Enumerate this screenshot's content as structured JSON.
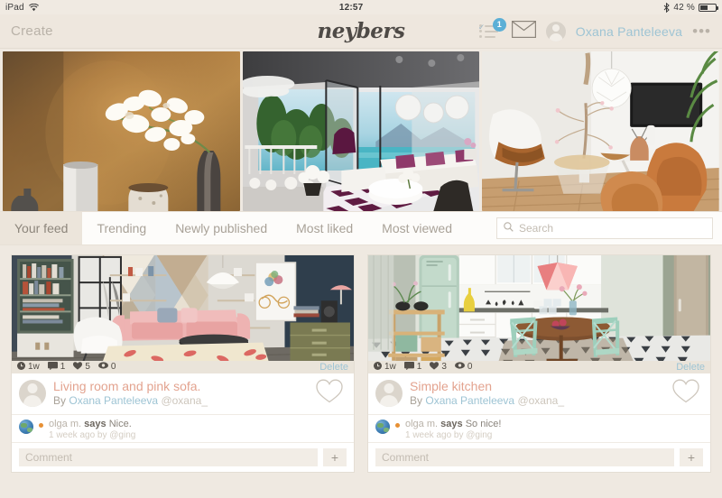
{
  "statusbar": {
    "device": "iPad",
    "wifi_icon": "wifi-icon",
    "time": "12:57",
    "bluetooth_icon": "bluetooth-icon",
    "battery_percent": "42 %",
    "battery_level": 42
  },
  "header": {
    "create_label": "Create",
    "logo": "neybers",
    "notifications_badge": "1",
    "notifications_icon": "checklist-icon",
    "mail_icon": "envelope-icon",
    "avatar_icon": "user-avatar-icon",
    "username": "Oxana  Panteleeva",
    "more_label": "•••"
  },
  "hero": [
    {
      "name": "hero-orchid-vases",
      "alt": "White orchid branch and vases against rust wall"
    },
    {
      "name": "hero-modern-living-room",
      "alt": "Modern living room with sea view and purple checkered rug"
    },
    {
      "name": "hero-scandi-lounge",
      "alt": "Scandinavian lounge with leather chairs and pendant lamp"
    }
  ],
  "tabs": [
    {
      "label": "Your feed",
      "active": true
    },
    {
      "label": "Trending",
      "active": false
    },
    {
      "label": "Newly published",
      "active": false
    },
    {
      "label": "Most liked",
      "active": false
    },
    {
      "label": "Most viewed",
      "active": false
    }
  ],
  "search": {
    "placeholder": "Search",
    "value": "",
    "icon": "search-icon"
  },
  "cards": [
    {
      "image_name": "card-image-living-room-pink-sofa",
      "stats": {
        "time_icon": "clock-icon",
        "time": "1w",
        "comments_icon": "comment-icon",
        "comments": "1",
        "likes_icon": "heart-icon",
        "likes": "5",
        "views_icon": "eye-icon",
        "views": "0"
      },
      "delete_label": "Delete",
      "title": "Living room and pink sofa.",
      "by_prefix": "By",
      "author": "Oxana  Panteleeva",
      "handle": "@oxana_",
      "like_icon": "heart-outline-icon",
      "comment": {
        "avatar_icon": "globe-avatar-icon",
        "user": "olga m.",
        "says": "says",
        "body": "Nice.",
        "meta": "1 week ago by @ging"
      },
      "comment_input_placeholder": "Comment",
      "comment_input_value": "",
      "add_label": "+"
    },
    {
      "image_name": "card-image-simple-kitchen",
      "stats": {
        "time_icon": "clock-icon",
        "time": "1w",
        "comments_icon": "comment-icon",
        "comments": "1",
        "likes_icon": "heart-icon",
        "likes": "3",
        "views_icon": "eye-icon",
        "views": "0"
      },
      "delete_label": "Delete",
      "title": "Simple kitchen",
      "by_prefix": "By",
      "author": "Oxana  Panteleeva",
      "handle": "@oxana_",
      "like_icon": "heart-outline-icon",
      "comment": {
        "avatar_icon": "globe-avatar-icon",
        "user": "olga m.",
        "says": "says",
        "body": "So nice!",
        "meta": "1 week ago by @ging"
      },
      "comment_input_placeholder": "Comment",
      "comment_input_value": "",
      "add_label": "+"
    }
  ],
  "colors": {
    "app_bg": "#efe9e1",
    "header_bg": "#eee7de",
    "accent_blue": "#9ec4d4",
    "title_salmon": "#e3a38f",
    "badge_blue": "#5bafd6",
    "tab_active_bg": "#ece5db"
  }
}
